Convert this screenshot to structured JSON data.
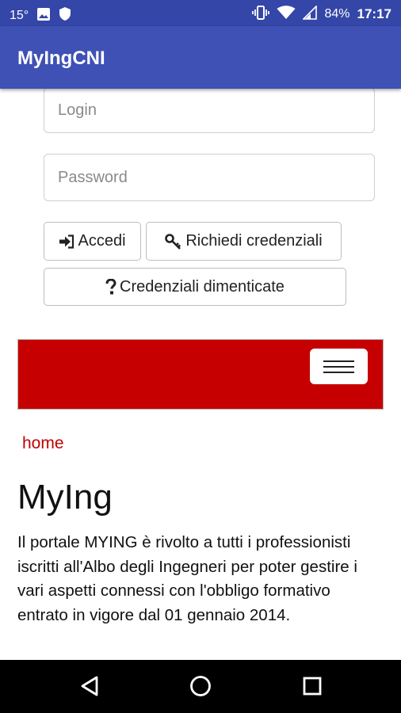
{
  "status_bar": {
    "temperature": "15°",
    "battery": "84%",
    "time": "17:17"
  },
  "app": {
    "title": "MyIngCNI"
  },
  "login_form": {
    "login_placeholder": "Login",
    "password_placeholder": "Password",
    "accedi_label": "Accedi",
    "richiedi_label": "Richiedi credenziali",
    "dimenticate_label": "Credenziali dimenticate"
  },
  "brand_color": "#c60000",
  "breadcrumb": {
    "home": "home"
  },
  "content": {
    "title": "MyIng",
    "intro": "Il portale MYING è rivolto a tutti i professionisti iscritti all'Albo degli Ingegneri per poter gestire i vari aspetti connessi con l'obbligo formativo entrato in vigore dal 01 gennaio 2014."
  }
}
